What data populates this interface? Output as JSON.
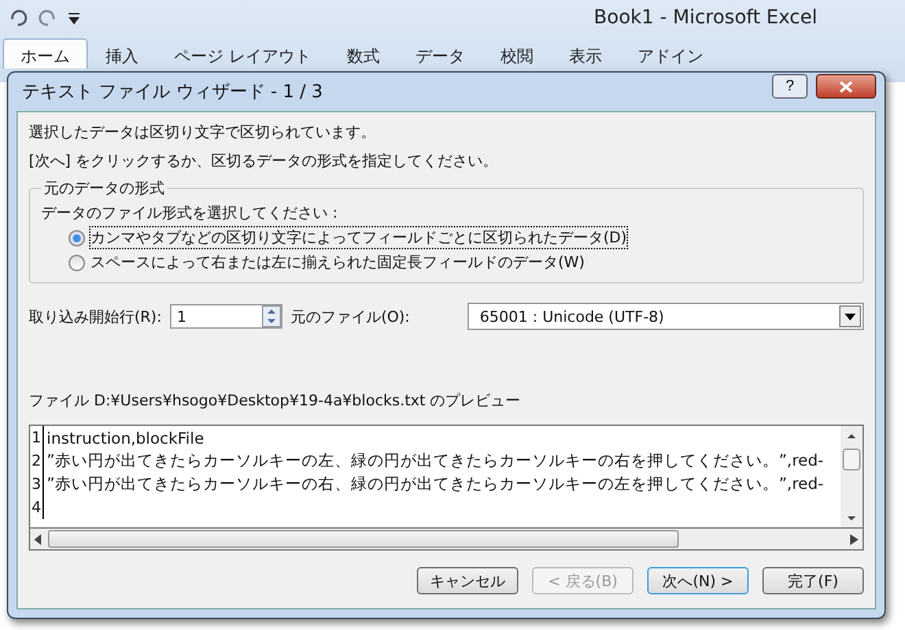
{
  "app": {
    "title": "Book1  -  Microsoft Excel",
    "ribbon_tabs": [
      {
        "label": "ホーム",
        "selected": true
      },
      {
        "label": "挿入",
        "selected": false
      },
      {
        "label": "ページ レイアウト",
        "selected": false
      },
      {
        "label": "数式",
        "selected": false
      },
      {
        "label": "データ",
        "selected": false
      },
      {
        "label": "校閲",
        "selected": false
      },
      {
        "label": "表示",
        "selected": false
      },
      {
        "label": "アドイン",
        "selected": false
      }
    ]
  },
  "dialog": {
    "title": "テキスト ファイル ウィザード - 1 / 3",
    "help": "?",
    "intro": [
      "選択したデータは区切り文字で区切られています。",
      "[次へ] をクリックするか、区切るデータの形式を指定してください。"
    ],
    "format_group": {
      "legend": "元のデータの形式",
      "prompt": "データのファイル形式を選択してください :",
      "options": [
        {
          "label": "カンマやタブなどの区切り文字によってフィールドごとに区切られたデータ(D)",
          "selected": true
        },
        {
          "label": "スペースによって右または左に揃えられた固定長フィールドのデータ(W)",
          "selected": false
        }
      ]
    },
    "start_row": {
      "label": "取り込み開始行(R):",
      "value": "1"
    },
    "origin": {
      "label": "元のファイル(O):",
      "value": "65001 : Unicode (UTF-8)"
    },
    "preview": {
      "label": "ファイル D:¥Users¥hsogo¥Desktop¥19-4a¥blocks.txt のプレビュー",
      "lines": [
        {
          "number": "1",
          "text": "instruction,blockFile"
        },
        {
          "number": "2",
          "text": "”赤い円が出てきたらカーソルキーの左、緑の円が出てきたらカーソルキーの右を押してください。”,red-"
        },
        {
          "number": "3",
          "text": "”赤い円が出てきたらカーソルキーの右、緑の円が出てきたらカーソルキーの左を押してください。”,red-"
        },
        {
          "number": "4"
        }
      ]
    },
    "buttons": [
      {
        "label": "キャンセル",
        "disabled": false,
        "default": false
      },
      {
        "label": "< 戻る(B)",
        "disabled": true,
        "default": false
      },
      {
        "label": "次へ(N) >",
        "disabled": false,
        "default": true
      },
      {
        "label": "完了(F)",
        "disabled": false,
        "default": false
      }
    ]
  }
}
